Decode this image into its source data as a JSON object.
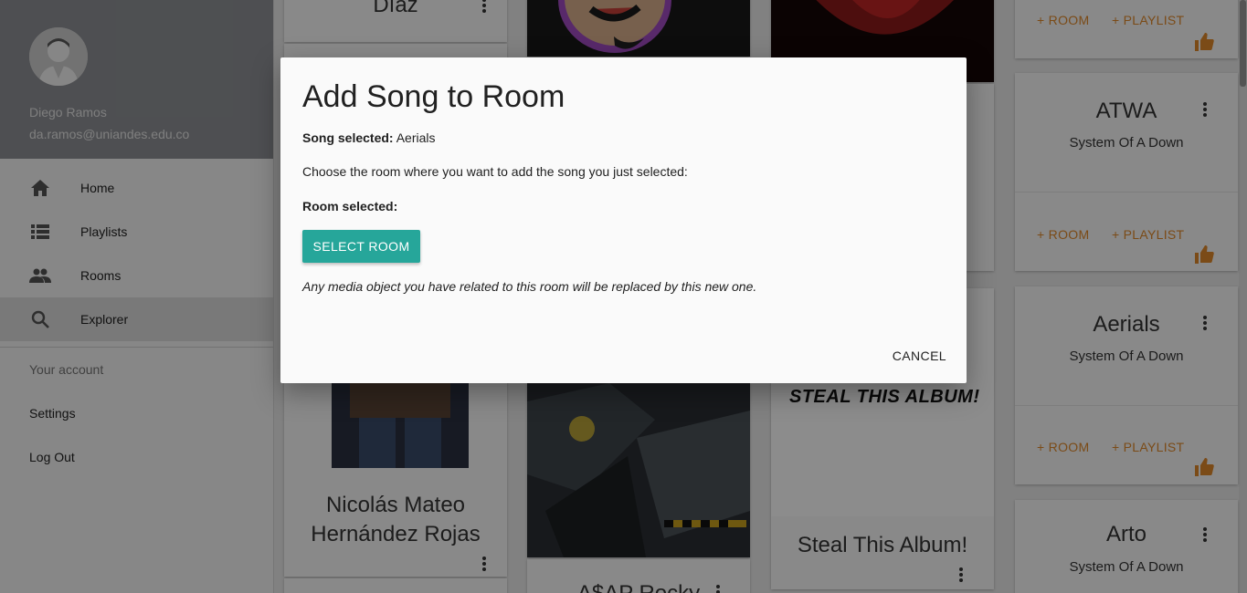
{
  "profile": {
    "name": "Diego Ramos",
    "email": "da.ramos@uniandes.edu.co"
  },
  "nav": [
    {
      "label": "Home",
      "icon": "home-icon"
    },
    {
      "label": "Playlists",
      "icon": "list-icon"
    },
    {
      "label": "Rooms",
      "icon": "people-icon"
    },
    {
      "label": "Explorer",
      "icon": "search-icon"
    }
  ],
  "account": {
    "header": "Your account",
    "settings": "Settings",
    "logout": "Log Out"
  },
  "artists": [
    {
      "name": "Díaz"
    },
    {
      "name": "Nicolás Mateo Hernández Rojas"
    },
    {
      "name": "A$AP Rocky"
    },
    {
      "name": "Steal This Album!"
    }
  ],
  "album_art_text": "STEAL THIS ALBUM!",
  "songs": [
    {
      "title": "ATWA",
      "artist": "System Of A Down"
    },
    {
      "title": "Aerials",
      "artist": "System Of A Down"
    },
    {
      "title": "Arto",
      "artist": "System Of A Down"
    }
  ],
  "actions": {
    "room": "+ ROOM",
    "playlist": "+ PLAYLIST"
  },
  "dialog": {
    "title": "Add Song to Room",
    "song_label": "Song selected:",
    "song_value": "Aerials",
    "instruction": "Choose the room where you want to add the song you just selected:",
    "room_label": "Room selected:",
    "select_button": "SELECT ROOM",
    "warning": "Any media object you have related to this room will be replaced by this new one.",
    "cancel_button": "CANCEL"
  },
  "colors": {
    "accent": "#26a69a",
    "action": "#e0892b",
    "thumb": "#e0892b"
  }
}
